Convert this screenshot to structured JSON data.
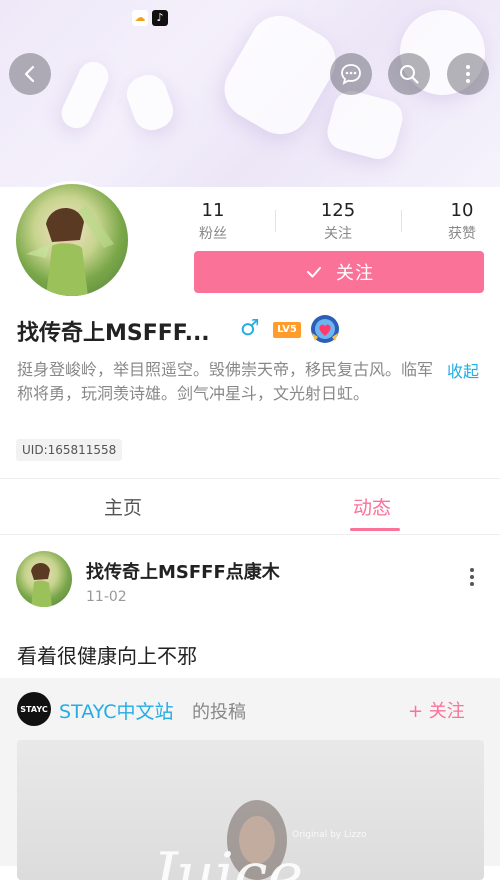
{
  "colors": {
    "accent": "#fb7299",
    "link": "#23ade5",
    "muted": "#888888"
  },
  "status_bar": {
    "icons": [
      "weather-icon",
      "tiktok-icon"
    ]
  },
  "header": {
    "back_icon": "back-icon",
    "actions": [
      "chat-icon",
      "search-icon",
      "more-icon"
    ]
  },
  "profile": {
    "stats": [
      {
        "value": "11",
        "label": "粉丝"
      },
      {
        "value": "125",
        "label": "关注"
      },
      {
        "value": "10",
        "label": "获赞"
      }
    ],
    "follow_label": "关注",
    "name": "找传奇上MSFFF...",
    "gender_symbol": "♂",
    "level_badge": "LV5",
    "bio": "挺身登峻岭，举目照遥空。毁佛崇天帝，移民复古风。临军称将勇，玩洞羡诗雄。剑气冲星斗，文光射日虹。",
    "collapse_label": "收起",
    "uid": "UID:165811558"
  },
  "tabs": [
    {
      "label": "主页",
      "active": false
    },
    {
      "label": "动态",
      "active": true
    }
  ],
  "post": {
    "author": "找传奇上MSFFF点康木",
    "date": "11-02",
    "text": "看着很健康向上不邪",
    "repost": {
      "source_avatar_text": "STAYC",
      "source_name": "STAYC中文站",
      "suffix": "的投稿",
      "follow_label": "+ 关注",
      "image_watermark": "Original by Lizzo",
      "image_text": "Juice"
    }
  }
}
